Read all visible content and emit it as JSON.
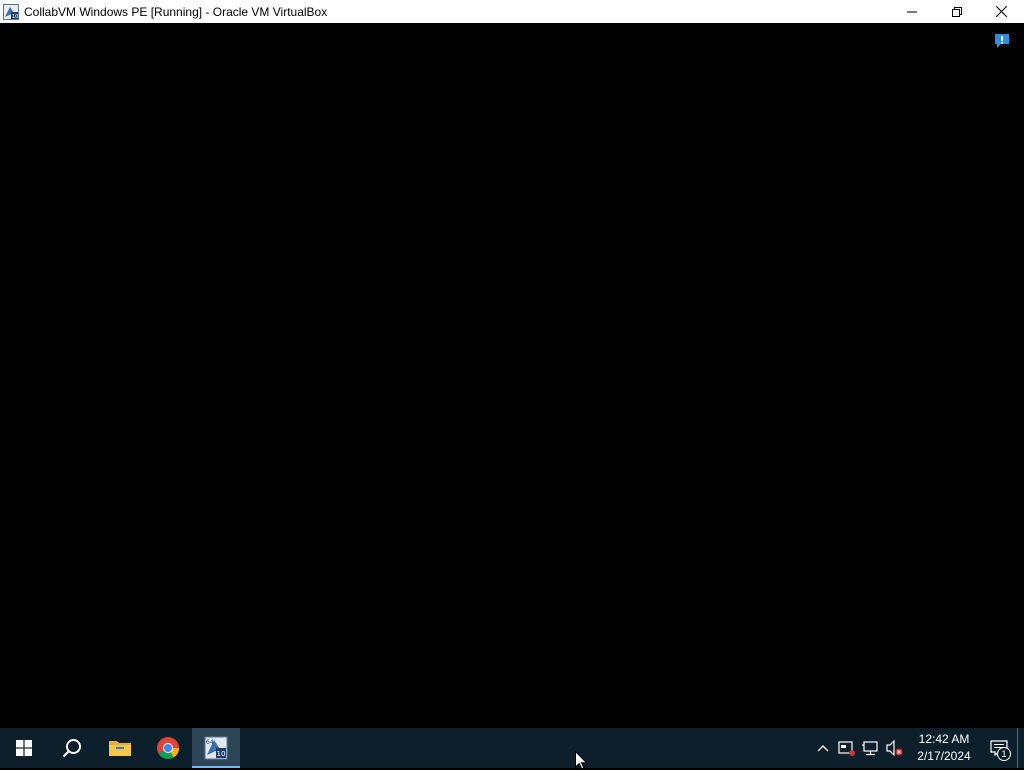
{
  "window": {
    "title": "CollabVM Windows PE [Running] - Oracle VM VirtualBox",
    "controls": [
      "minimize-icon",
      "restore-icon",
      "close-icon"
    ]
  },
  "vm_screen": {
    "background": "#000000",
    "notification_icon": "info-notification-icon"
  },
  "taskbar": {
    "background": "#0d1f2b",
    "accent": "#76b9ed",
    "pinned": [
      {
        "name": "start",
        "icon": "windows-logo-icon"
      },
      {
        "name": "search",
        "icon": "search-icon"
      },
      {
        "name": "file-explorer",
        "icon": "folder-icon"
      },
      {
        "name": "chrome",
        "icon": "chrome-icon"
      },
      {
        "name": "virtualbox",
        "icon": "virtualbox-icon",
        "active": true
      }
    ],
    "tray": {
      "icons": [
        "chevron-up-icon",
        "safely-remove-icon",
        "network-icon",
        "volume-muted-icon"
      ],
      "time": "12:42 AM",
      "date": "2/17/2024",
      "notification_count": "1"
    }
  }
}
